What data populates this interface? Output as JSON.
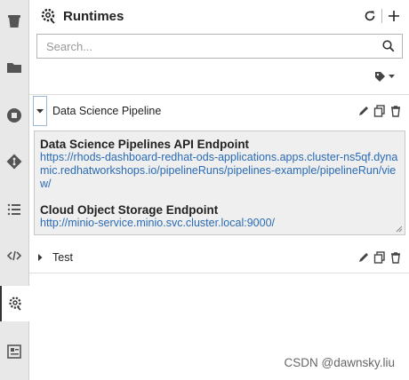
{
  "header": {
    "title": "Runtimes"
  },
  "search": {
    "placeholder": "Search..."
  },
  "runtimes": [
    {
      "name": "Data Science Pipeline",
      "expanded": true,
      "details": [
        {
          "label": "Data Science Pipelines API Endpoint",
          "value": "https://rhods-dashboard-redhat-ods-applications.apps.cluster-ns5qf.dynamic.redhatworkshops.io/pipelineRuns/pipelines-example/pipelineRun/view/"
        },
        {
          "label": "Cloud Object Storage Endpoint",
          "value": "http://minio-service.minio.svc.cluster.local:9000/"
        }
      ]
    },
    {
      "name": "Test",
      "expanded": false
    }
  ],
  "watermark": "CSDN @dawnsky.liu",
  "colors": {
    "link": "#2a6bb4",
    "active_bar": "#333333",
    "details_bg": "#efefef"
  }
}
